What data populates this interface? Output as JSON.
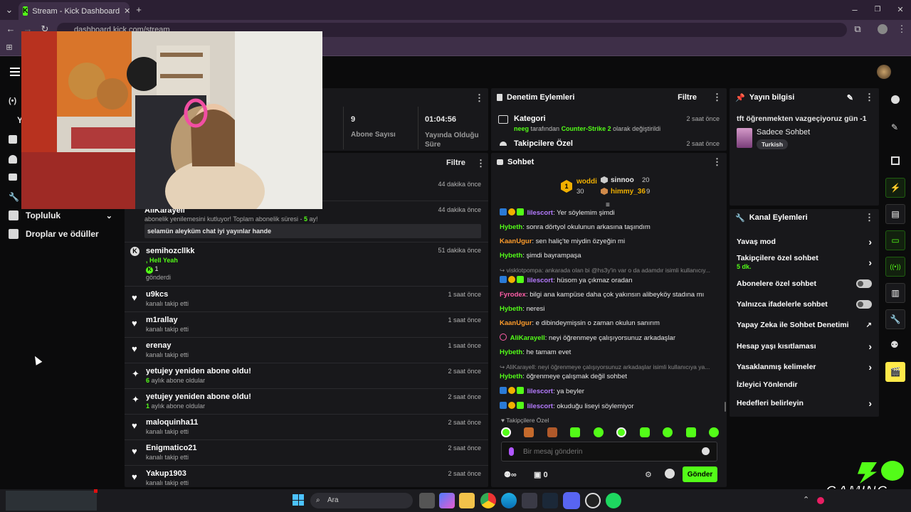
{
  "browser": {
    "tab_title": "Stream - Kick Dashboard",
    "url": "dashboard.kick.com/stream"
  },
  "sidebar": {
    "items": [
      {
        "label": "Topluluk"
      },
      {
        "label": "Droplar ve ödüller"
      }
    ],
    "y_label": "Y"
  },
  "stats": [
    {
      "value": "9",
      "label": "Abone Sayısı"
    },
    {
      "value": "01:04:56",
      "label": "Yayında Olduğu Süre"
    }
  ],
  "activity": {
    "filter_label": "Filtre",
    "first_time": "44 dakika önce",
    "events": [
      {
        "name": "AliKarayell",
        "sub": "abonelik yenilemesini kutluyor! Toplam abonelik süresi - ",
        "sub_hl": "5",
        "sub_tail": " ay!",
        "msg": "selamün aleyküm chat iyi yayınlar hande",
        "time": "44 dakika önce",
        "icon": "sub-icon"
      },
      {
        "name": "semihozcllkk",
        "line2": ", Hell Yeah",
        "kicks": "1",
        "line3": "gönderdi",
        "time": "51 dakika önce",
        "icon": "kick-icon"
      },
      {
        "name": "u9kcs",
        "sub": "kanalı takip etti",
        "time": "1 saat önce",
        "icon": "heart-icon"
      },
      {
        "name": "m1rallay",
        "sub": "kanalı takip etti",
        "time": "1 saat önce",
        "icon": "heart-icon"
      },
      {
        "name": "erenay",
        "sub": "kanalı takip etti",
        "time": "1 saat önce",
        "icon": "heart-icon"
      },
      {
        "name": "yetujey yeniden abone oldu!",
        "sub_hl": "6",
        "sub": " aylık abone oldular",
        "time": "2 saat önce",
        "icon": "sparkle-icon"
      },
      {
        "name": "yetujey yeniden abone oldu!",
        "sub_hl": "1",
        "sub": " aylık abone oldular",
        "time": "2 saat önce",
        "icon": "sparkle-icon"
      },
      {
        "name": "maloquinha11",
        "sub": "kanalı takip etti",
        "time": "2 saat önce",
        "icon": "heart-icon"
      },
      {
        "name": "Enigmatico21",
        "sub": "kanalı takip etti",
        "time": "2 saat önce",
        "icon": "heart-icon"
      },
      {
        "name": "Yakup1903",
        "sub": "kanalı takip etti",
        "time": "2 saat önce",
        "icon": "heart-icon"
      }
    ]
  },
  "moderation": {
    "title": "Denetim Eylemleri",
    "filter_label": "Filtre",
    "entries": [
      {
        "title": "Kategori",
        "user": "neeg",
        "mid": " tarafından ",
        "target": "Counter-Strike 2",
        "tail": " olarak değiştirildi",
        "time": "2 saat önce"
      },
      {
        "title": "Takipcilere Özel",
        "time": "2 saat önce"
      }
    ]
  },
  "chat": {
    "title": "Sohbet",
    "leaderboard": [
      {
        "rank": "1",
        "name": "woddi",
        "count": "30"
      },
      {
        "name": "sinnoo",
        "count": "20"
      },
      {
        "name": "himmy_36",
        "count": "9"
      }
    ],
    "messages": [
      {
        "user": "lilescort",
        "color": "#b57bff",
        "text": ": Yer söylemim şimdi",
        "badges": true
      },
      {
        "user": "Hybeth",
        "color": "#53fc18",
        "text": ": sonra dörtyol okulunun arkasına taşındım"
      },
      {
        "user": "KaanUgur",
        "color": "#ff9c2b",
        "text": ": sen haliç'te miydin özyeğin mi"
      },
      {
        "user": "Hybeth",
        "color": "#53fc18",
        "text": ": şimdi bayrampaşa"
      },
      {
        "reply": "visklotpompa: ankarada olan bi @hs3y'in var o da adamdır isimli kullanıcıy..."
      },
      {
        "user": "lilescort",
        "color": "#b57bff",
        "text": ": hüsom ya çıkmaz oradan",
        "badges": true
      },
      {
        "user": "Fyrodex",
        "color": "#ff5ea8",
        "text": ": bilgi ana kampüse daha çok yakınsın alibeyköy stadına mı"
      },
      {
        "user": "Hybeth",
        "color": "#53fc18",
        "text": ": neresi"
      },
      {
        "user": "KaanUgur",
        "color": "#ff9c2b",
        "text": ": e dibindeymişsin o zaman okulun sanırım"
      },
      {
        "user": "AliKarayell",
        "color": "#53fc18",
        "text": ": neyi öğrenmeye çalışıyorsunuz arkadaşlar",
        "sub": true
      },
      {
        "user": "Hybeth",
        "color": "#53fc18",
        "text": ": he tamam evet"
      },
      {
        "reply": "AliKarayell: neyi öğrenmeye çalışıyorsunuz arkadaşlar isimli kullanıcıya ya..."
      },
      {
        "user": "Hybeth",
        "color": "#53fc18",
        "text": ": öğrenmeye çalışmak değil sohbet"
      },
      {
        "user": "lilescort",
        "color": "#b57bff",
        "text": ": ya beyler",
        "badges": true
      },
      {
        "user": "lilescort",
        "color": "#b57bff",
        "text": ": okuduğu liseyi söylemiyor",
        "badges": true
      }
    ],
    "followers_only": "Takipçilere Özel",
    "input_placeholder": "Bir mesaj gönderin",
    "infinity": "∞",
    "gift_count": "0",
    "send_label": "Gönder"
  },
  "stream_info": {
    "title": "Yayın bilgisi",
    "stream_title": "tft öğrenmekten vazgeçiyoruz gün -1",
    "category": "Sadece Sohbet",
    "tag": "Turkish"
  },
  "channel_actions": {
    "title": "Kanal Eylemleri",
    "items": [
      {
        "label": "Yavaş mod",
        "control": "chevron"
      },
      {
        "label": "Takipçilere özel sohbet",
        "value": "5 dk.",
        "control": "chevron"
      },
      {
        "label": "Abonelere özel sohbet",
        "control": "toggle"
      },
      {
        "label": "Yalnızca ifadelerle sohbet",
        "control": "toggle"
      },
      {
        "label": "Yapay Zeka ile Sohbet Denetimi",
        "control": "external"
      },
      {
        "label": "Hesap yaşı kısıtlaması",
        "control": "chevron"
      },
      {
        "label": "Yasaklanmış kelimeler",
        "control": "chevron"
      },
      {
        "label": "İzleyici Yönlendir",
        "control": "none"
      },
      {
        "label": "Hedefleri belirleyin",
        "control": "chevron"
      }
    ]
  },
  "taskbar": {
    "search_label": "Ara"
  },
  "watermark": "GAMING",
  "colors": {
    "kick_green": "#53fc18",
    "panel": "#18181b",
    "bg": "#0b0b0c",
    "chrome": "#3e2f48"
  }
}
